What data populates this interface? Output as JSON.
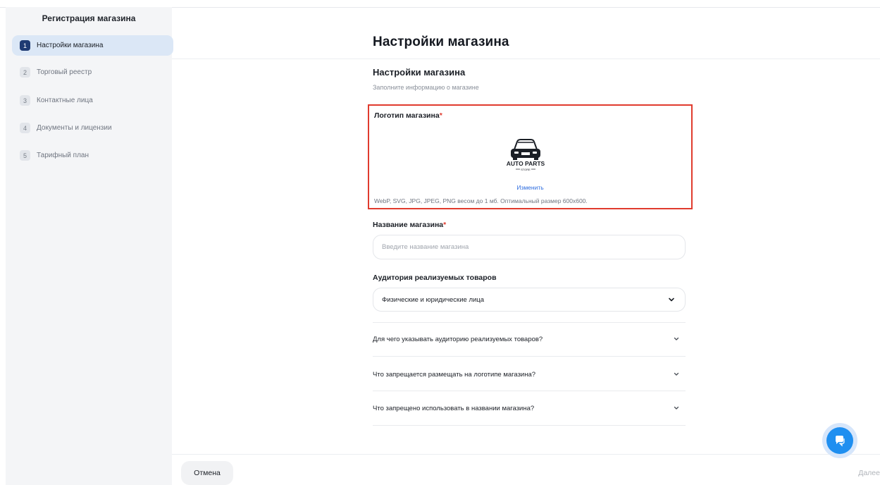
{
  "sidebar": {
    "title": "Регистрация магазина",
    "steps": [
      {
        "num": "1",
        "label": "Настройки магазина",
        "active": true
      },
      {
        "num": "2",
        "label": "Торговый реестр",
        "active": false
      },
      {
        "num": "3",
        "label": "Контактные лица",
        "active": false
      },
      {
        "num": "4",
        "label": "Документы и лицензии",
        "active": false
      },
      {
        "num": "5",
        "label": "Тарифный план",
        "active": false
      }
    ]
  },
  "main": {
    "page_title": "Настройки магазина",
    "section_title": "Настройки магазина",
    "section_subtitle": "Заполните информацию о магазине",
    "logo": {
      "label": "Логотип магазина",
      "required_mark": "*",
      "brand_text": "AUTO PARTS",
      "brand_subtext": "STORE",
      "change_link": "Изменить",
      "hint": "WebP, SVG, JPG, JPEG, PNG весом до 1 мб. Оптимальный размер 600x600."
    },
    "store_name": {
      "label": "Название магазина",
      "required_mark": "*",
      "value": "",
      "placeholder": "Введите название магазина"
    },
    "audience": {
      "label": "Аудитория реализуемых товаров",
      "selected": "Физические и юридические лица",
      "icon": "chevron-down-icon"
    },
    "faq": [
      {
        "question": "Для чего указывать аудиторию реализуемых товаров?"
      },
      {
        "question": "Что запрещается размещать на логотипе магазина?"
      },
      {
        "question": "Что запрещено использовать в названии магазина?"
      }
    ]
  },
  "footer": {
    "cancel_label": "Отмена",
    "next_label": "Далее"
  },
  "colors": {
    "accent": "#1f8ff0",
    "active_step": "#1f3b73",
    "highlight_border": "#e03b2e",
    "link": "#2d6cdf"
  }
}
